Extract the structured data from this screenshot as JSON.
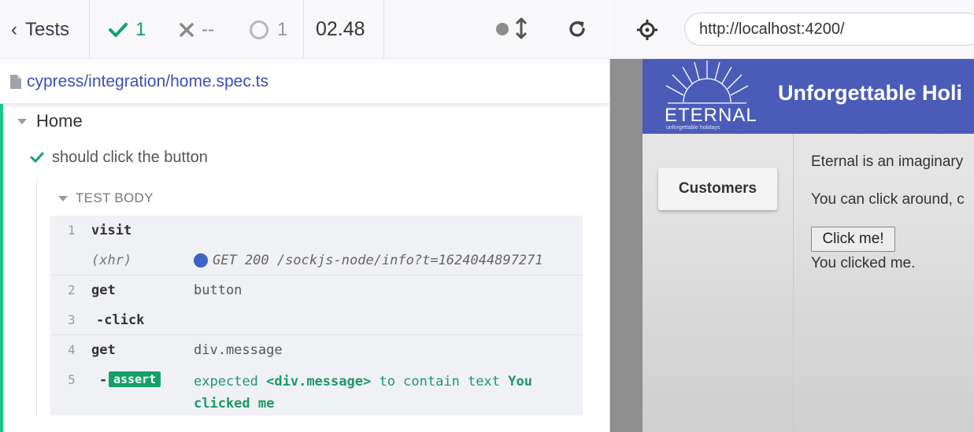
{
  "reporter": {
    "tests_label": "Tests",
    "passed_count": "1",
    "failed_count": "--",
    "pending_count": "1",
    "duration": "02.48",
    "spec_path": "cypress/integration/home.spec.ts",
    "suite_title": "Home",
    "test_title": "should click the button",
    "test_body_label": "TEST BODY",
    "commands": [
      {
        "num": "1",
        "name": "visit",
        "message": ""
      },
      {
        "num": "",
        "name": "(xhr)",
        "message": "GET 200 /sockjs-node/info?t=1624044897271"
      },
      {
        "num": "2",
        "name": "get",
        "message": "button"
      },
      {
        "num": "3",
        "name": "-click",
        "message": ""
      },
      {
        "num": "4",
        "name": "get",
        "message": "div.message"
      },
      {
        "num": "5",
        "name": "-",
        "badge": "assert",
        "message_parts": [
          "expected",
          "<div.message>",
          "to contain text",
          "You clicked me"
        ]
      }
    ],
    "colors": {
      "passed": "#15a06a",
      "accent_edge": "#17c983",
      "spec_link": "#3a4fb5"
    }
  },
  "browser": {
    "url": "http://localhost:4200/"
  },
  "app": {
    "logo_text": "ETERNAL",
    "logo_tagline": "unforgettable holidays",
    "title": "Unforgettable Holi",
    "nav_button": "Customers",
    "line1": "Eternal is an imaginary",
    "line2": "You can click around, c",
    "click_button": "Click me!",
    "message": "You clicked me.",
    "header_color": "#4a5cb8"
  },
  "icons": [
    "chevron-left-icon",
    "check-icon",
    "x-icon",
    "spinner-icon",
    "dot-icon",
    "updown-arrow-icon",
    "reload-icon",
    "file-icon",
    "caret-down-icon",
    "crosshair-icon",
    "sun-logo-icon"
  ]
}
